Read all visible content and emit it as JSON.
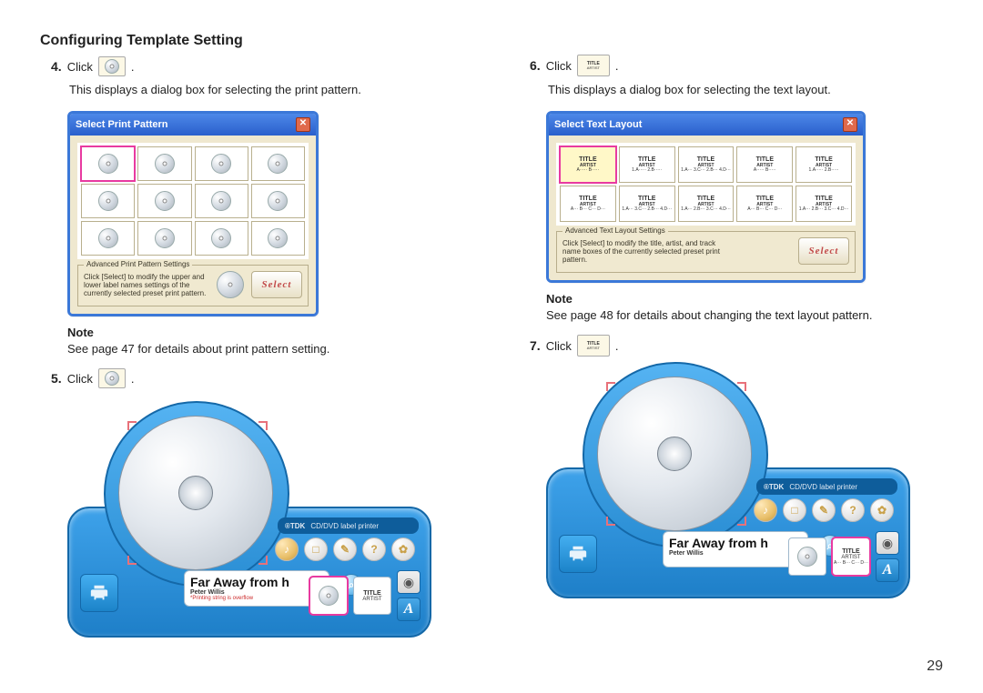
{
  "section_heading": "Configuring Template Setting",
  "page_number": "29",
  "left": {
    "step4": {
      "num": "4.",
      "text": "Click",
      "tail": "."
    },
    "step4_desc": "This displays a dialog box for selecting the print pattern.",
    "dialog_pp": {
      "title": "Select Print Pattern",
      "legend": "Advanced Print Pattern Settings",
      "hint": "Click [Select] to modify the upper and lower label names settings of the currently selected preset print pattern.",
      "select_btn": "Select"
    },
    "note_label": "Note",
    "note_text": "See page 47 for details about print pattern setting.",
    "step5": {
      "num": "5.",
      "text": "Click",
      "tail": "."
    }
  },
  "right": {
    "step6": {
      "num": "6.",
      "text": "Click",
      "tail": "."
    },
    "step6_desc": "This displays a dialog box for selecting the text layout.",
    "dialog_tl": {
      "title": "Select Text Layout",
      "legend": "Advanced Text Layout Settings",
      "hint": "Click [Select] to modify the title, artist, and track name boxes of the currently selected preset print pattern.",
      "select_btn": "Select",
      "cell_title": "TITLE",
      "cell_artist": "ARTIST"
    },
    "note_label": "Note",
    "note_text": "See page 48 for details about changing the text layout pattern.",
    "step7": {
      "num": "7.",
      "text": "Click",
      "tail": "."
    }
  },
  "printer": {
    "brand": "®TDK",
    "brand_desc": "CD/DVD label printer",
    "title_main": "Far Away from h",
    "title_sub": "Peter Willis",
    "title_warn": "*Printing string is overflow",
    "thumb_title": "TITLE",
    "thumb_artist": "ARTIST"
  }
}
